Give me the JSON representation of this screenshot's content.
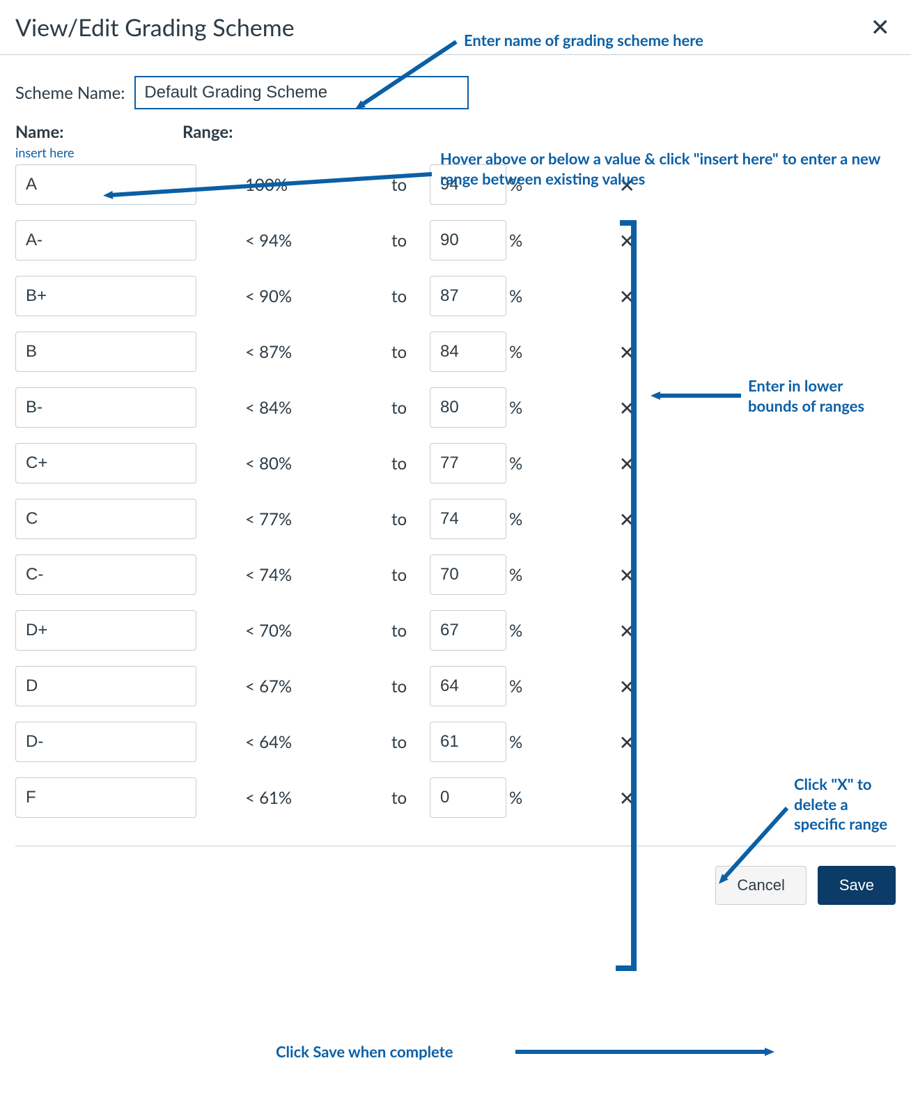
{
  "header": {
    "title": "View/Edit Grading Scheme"
  },
  "scheme_name": {
    "label": "Scheme Name:",
    "value": "Default Grading Scheme"
  },
  "col_headers": {
    "name": "Name:",
    "range": "Range:"
  },
  "links": {
    "insert_here": "insert here"
  },
  "misc": {
    "to": "to",
    "percent": "%"
  },
  "rows": [
    {
      "name": "A",
      "upper": "100%",
      "lower": "94"
    },
    {
      "name": "A-",
      "upper": "< 94%",
      "lower": "90"
    },
    {
      "name": "B+",
      "upper": "< 90%",
      "lower": "87"
    },
    {
      "name": "B",
      "upper": "< 87%",
      "lower": "84"
    },
    {
      "name": "B-",
      "upper": "< 84%",
      "lower": "80"
    },
    {
      "name": "C+",
      "upper": "< 80%",
      "lower": "77"
    },
    {
      "name": "C",
      "upper": "< 77%",
      "lower": "74"
    },
    {
      "name": "C-",
      "upper": "< 74%",
      "lower": "70"
    },
    {
      "name": "D+",
      "upper": "< 70%",
      "lower": "67"
    },
    {
      "name": "D",
      "upper": "< 67%",
      "lower": "64"
    },
    {
      "name": "D-",
      "upper": "< 64%",
      "lower": "61"
    },
    {
      "name": "F",
      "upper": "< 61%",
      "lower": "0"
    }
  ],
  "footer": {
    "cancel": "Cancel",
    "save": "Save"
  },
  "annotations": {
    "a1": "Enter name of grading scheme here",
    "a2": "Hover above or below a value & click \"insert here\" to enter a new range between existing values",
    "a3": "Enter in lower bounds of ranges",
    "a4": "Click \"X\" to delete a specific range",
    "a5": "Click Save when complete"
  },
  "colors": {
    "accent_blue": "#0b5fa5",
    "save_bg": "#0b3b66"
  }
}
